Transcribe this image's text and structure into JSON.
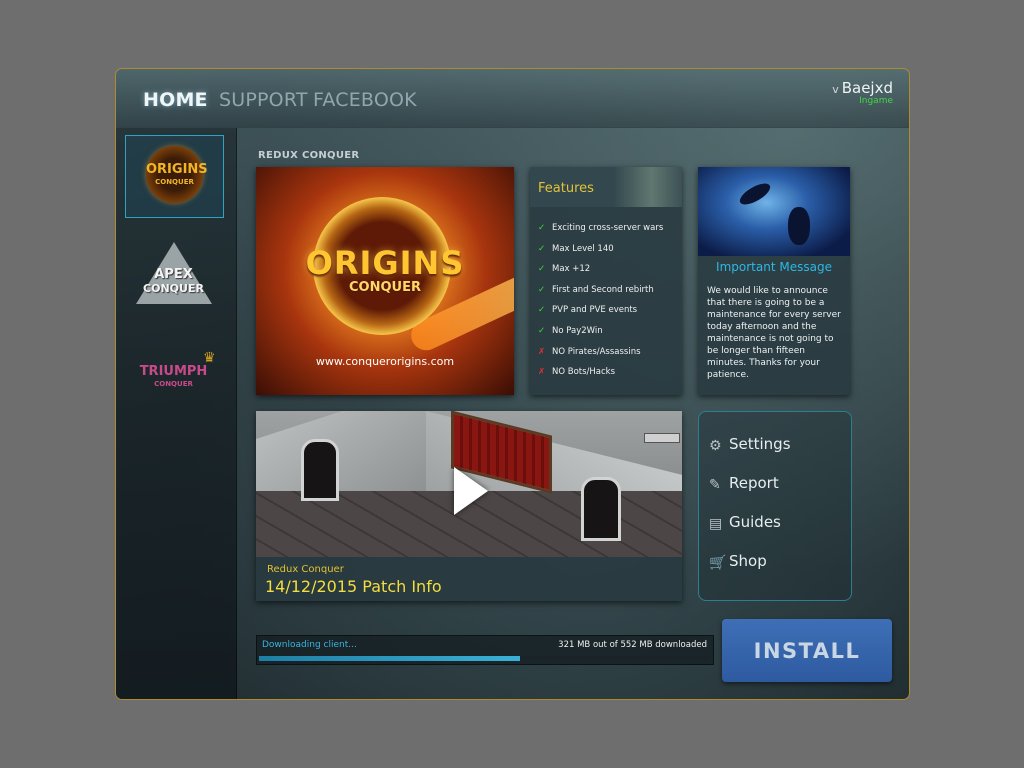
{
  "nav": {
    "items": [
      {
        "label": "HOME",
        "active": true
      },
      {
        "label": "SUPPORT",
        "active": false
      },
      {
        "label": "FACEBOOK",
        "active": false
      }
    ]
  },
  "user": {
    "name": "Baejxd",
    "status": "Ingame",
    "status_color": "#45d445"
  },
  "games": [
    {
      "name": "ORIGINS",
      "sub": "CONQUER",
      "selected": true
    },
    {
      "name": "APEX",
      "sub": "CONQUER",
      "selected": false
    },
    {
      "name": "TRIUMPH",
      "sub": "CONQUER",
      "selected": false
    }
  ],
  "section_title": "REDUX CONQUER",
  "banner": {
    "logo": "ORIGINS",
    "sub": "CONQUER",
    "url": "www.conquerorigins.com"
  },
  "features": {
    "title": "Features",
    "items": [
      {
        "text": "Exciting cross-server wars",
        "mark": "✓",
        "available": true
      },
      {
        "text": "Max Level 140",
        "mark": "✓",
        "available": true
      },
      {
        "text": "Max +12",
        "mark": "✓",
        "available": true
      },
      {
        "text": "First and Second rebirth",
        "mark": "✓",
        "available": true
      },
      {
        "text": "PVP and PVE events",
        "mark": "✓",
        "available": true
      },
      {
        "text": "No Pay2Win",
        "mark": "✓",
        "available": true
      },
      {
        "text": "NO Pirates/Assassins",
        "mark": "✗",
        "available": false
      },
      {
        "text": "NO Bots/Hacks",
        "mark": "✗",
        "available": false
      }
    ]
  },
  "message": {
    "title": "Important Message",
    "body": "We would like to announce that there is going to be a maintenance for every server today afternoon and the maintenance is not going to be longer than fifteen minutes. Thanks for your patience."
  },
  "video": {
    "caption_small": "Redux Conquer",
    "caption": "14/12/2015 Patch Info"
  },
  "links": [
    {
      "label": "Settings",
      "icon": "gear-icon"
    },
    {
      "label": "Report",
      "icon": "report-icon"
    },
    {
      "label": "Guides",
      "icon": "guide-icon"
    },
    {
      "label": "Shop",
      "icon": "cart-icon"
    }
  ],
  "download": {
    "label": "Downloading client...",
    "status": "321 MB out of 552 MB downloaded",
    "progress": 0.58
  },
  "install_label": "INSTALL",
  "colors": {
    "accent": "#2fa3c2",
    "gold": "#e2c23a",
    "install": "#2e5aa0"
  }
}
